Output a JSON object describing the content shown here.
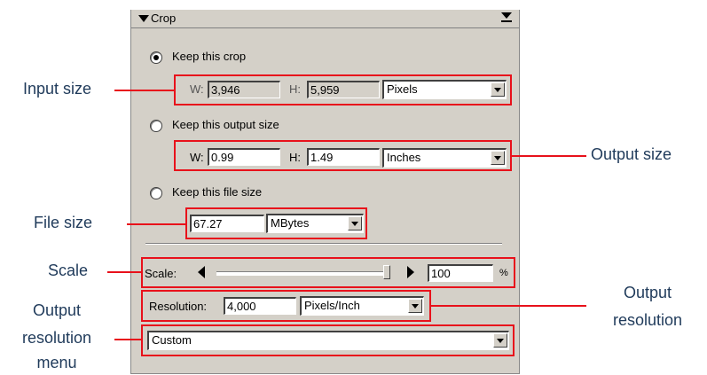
{
  "panel": {
    "title": "Crop",
    "keep_crop_label": "Keep this crop",
    "keep_output_label": "Keep this output size",
    "keep_file_label": "Keep this file size",
    "selected_option": "keep_crop",
    "input_size": {
      "w_label": "W:",
      "w_value": "3,946",
      "h_label": "H:",
      "h_value": "5,959",
      "unit": "Pixels"
    },
    "output_size": {
      "w_label": "W:",
      "w_value": "0.99",
      "h_label": "H:",
      "h_value": "1.49",
      "unit": "Inches"
    },
    "file_size": {
      "value": "67.27",
      "unit": "MBytes"
    },
    "scale": {
      "label": "Scale:",
      "value": "100",
      "unit": "%",
      "slider_level": 1.0
    },
    "resolution": {
      "label": "Resolution:",
      "value": "4,000",
      "unit": "Pixels/Inch"
    },
    "resolution_menu": {
      "value": "Custom"
    }
  },
  "callouts": {
    "input_size": "Input size",
    "file_size": "File size",
    "scale": "Scale",
    "output_resolution_menu_1": "Output",
    "output_resolution_menu_2": "resolution",
    "output_resolution_menu_3": "menu",
    "output_size": "Output size",
    "output_resolution_1": "Output",
    "output_resolution_2": "resolution"
  },
  "colors": {
    "accent": "#e8111b",
    "callout_text": "#1f3a5a",
    "panel_bg": "#d4d0c8"
  }
}
